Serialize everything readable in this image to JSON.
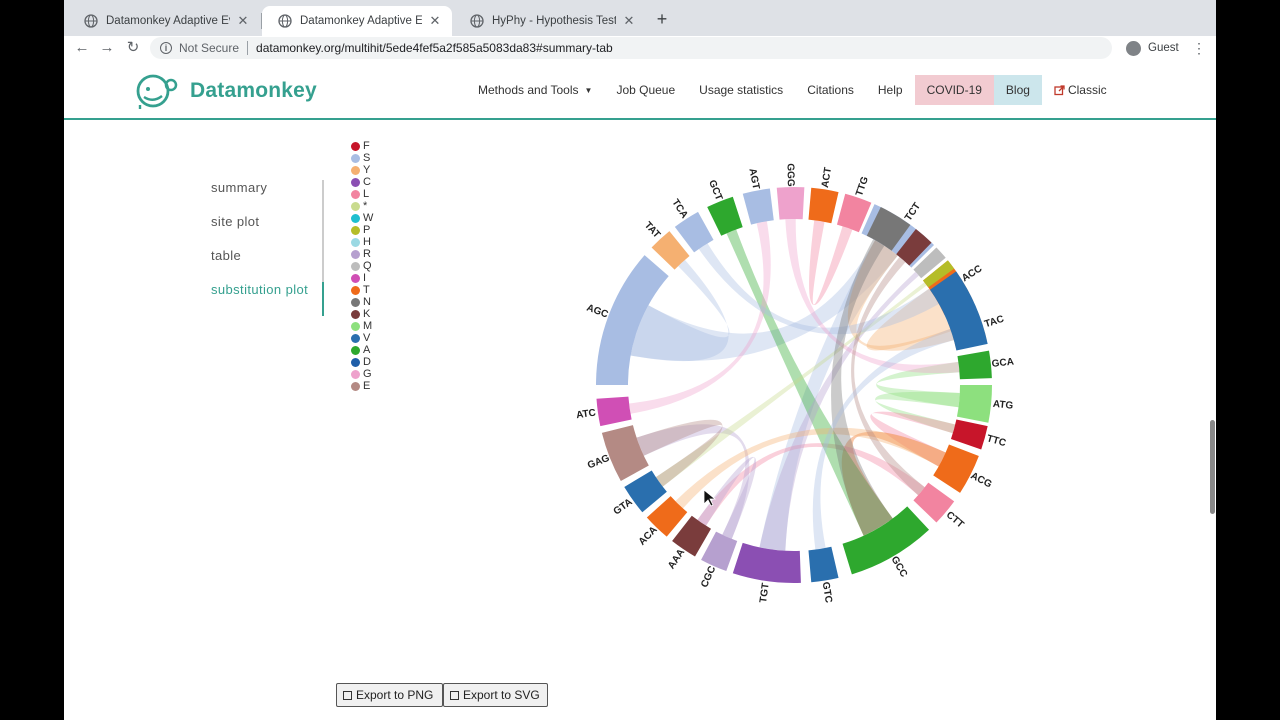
{
  "browser": {
    "tabs": [
      {
        "title": "Datamonkey Adaptive Evolution",
        "active": false
      },
      {
        "title": "Datamonkey Adaptive Evolution",
        "active": true
      },
      {
        "title": "HyPhy - Hypothesis Testing us",
        "active": false
      }
    ],
    "security_label": "Not Secure",
    "url": "datamonkey.org/multihit/5ede4fef5a2f585a5083da83#summary-tab",
    "profile_label": "Guest"
  },
  "site": {
    "brand": "Datamonkey",
    "nav": {
      "methods": "Methods and Tools",
      "queue": "Job Queue",
      "usage": "Usage statistics",
      "citations": "Citations",
      "help": "Help",
      "covid": "COVID-19",
      "blog": "Blog",
      "classic": "Classic"
    },
    "colors": {
      "accent": "#35a08f",
      "covid_bg": "#f2cbd1",
      "blog_bg": "#cce6ec"
    }
  },
  "sidebar": {
    "items": [
      {
        "label": "summary",
        "active": false
      },
      {
        "label": "site plot",
        "active": false
      },
      {
        "label": "table",
        "active": false
      },
      {
        "label": "substitution plot",
        "active": true
      }
    ]
  },
  "legend": [
    {
      "label": "F",
      "color": "#c7152a"
    },
    {
      "label": "S",
      "color": "#a8bde3"
    },
    {
      "label": "Y",
      "color": "#f5b071"
    },
    {
      "label": "C",
      "color": "#8b4fb3"
    },
    {
      "label": "L",
      "color": "#f284a0"
    },
    {
      "label": "*",
      "color": "#c9db8e"
    },
    {
      "label": "W",
      "color": "#1fbfcf"
    },
    {
      "label": "P",
      "color": "#b5bd28"
    },
    {
      "label": "H",
      "color": "#9bd9e3"
    },
    {
      "label": "R",
      "color": "#b6a0cf"
    },
    {
      "label": "Q",
      "color": "#bdbdbd"
    },
    {
      "label": "I",
      "color": "#d04fb5"
    },
    {
      "label": "T",
      "color": "#ef6b1a"
    },
    {
      "label": "N",
      "color": "#777777"
    },
    {
      "label": "K",
      "color": "#7a3c3c"
    },
    {
      "label": "M",
      "color": "#8de07e"
    },
    {
      "label": "V",
      "color": "#2a6fae"
    },
    {
      "label": "A",
      "color": "#2ea82e"
    },
    {
      "label": "D",
      "color": "#1f5ea8"
    },
    {
      "label": "G",
      "color": "#eea2cc"
    },
    {
      "label": "E",
      "color": "#b48a84"
    }
  ],
  "chart_data": {
    "type": "chord",
    "arcs": [
      {
        "label": "TCT",
        "color": "#a8bde3"
      },
      {
        "label": "ACC",
        "color": "#ef6b1a"
      },
      {
        "label": "TAC",
        "color": "#f5b071"
      },
      {
        "label": "GCA",
        "color": "#2ea82e"
      },
      {
        "label": "ATG",
        "color": "#8de07e"
      },
      {
        "label": "TTC",
        "color": "#c7152a"
      },
      {
        "label": "ACG",
        "color": "#ef6b1a"
      },
      {
        "label": "CTT",
        "color": "#f284a0"
      },
      {
        "label": "GCC",
        "color": "#2ea82e"
      },
      {
        "label": "GTC",
        "color": "#2a6fae"
      },
      {
        "label": "TGT",
        "color": "#8b4fb3"
      },
      {
        "label": "CGC",
        "color": "#b6a0cf"
      },
      {
        "label": "AAA",
        "color": "#7a3c3c"
      },
      {
        "label": "ACA",
        "color": "#ef6b1a"
      },
      {
        "label": "GTA",
        "color": "#2a6fae"
      },
      {
        "label": "GAG",
        "color": "#b48a84"
      },
      {
        "label": "ATC",
        "color": "#d04fb5"
      },
      {
        "label": "AGC",
        "color": "#a8bde3"
      },
      {
        "label": "TAT",
        "color": "#f5b071"
      },
      {
        "label": "TCA",
        "color": "#a8bde3"
      },
      {
        "label": "GCT",
        "color": "#2ea82e"
      },
      {
        "label": "AGT",
        "color": "#a8bde3"
      },
      {
        "label": "GGG",
        "color": "#eea2cc"
      },
      {
        "label": "ACT",
        "color": "#ef6b1a"
      },
      {
        "label": "TTG",
        "color": "#f284a0"
      },
      {
        "label": "",
        "color": "#777777"
      },
      {
        "label": "",
        "color": "#7a3c3c"
      },
      {
        "label": "",
        "color": "#bdbdbd"
      },
      {
        "label": "",
        "color": "#b5bd28"
      },
      {
        "label": "",
        "color": "#2a6fae"
      }
    ]
  },
  "buttons": {
    "export_png": "Export to PNG",
    "export_svg": "Export to SVG"
  }
}
